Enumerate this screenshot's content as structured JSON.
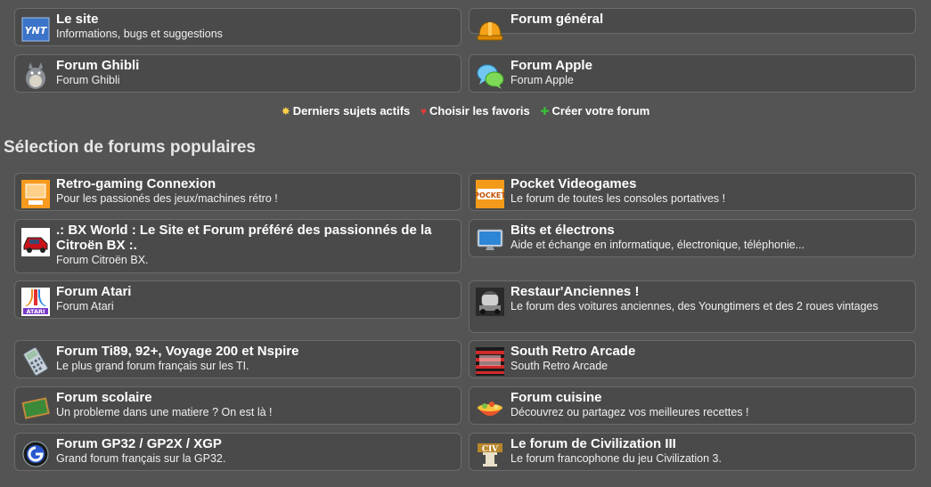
{
  "top_forums": [
    {
      "title": "Le site",
      "desc": "Informations, bugs et suggestions",
      "icon": "ynt-logo-icon"
    },
    {
      "title": "Forum général",
      "desc": "",
      "icon": "hardhat-icon"
    },
    {
      "title": "Forum Ghibli",
      "desc": "Forum Ghibli",
      "icon": "totoro-icon"
    },
    {
      "title": "Forum Apple",
      "desc": "Forum Apple",
      "icon": "chat-bubbles-icon"
    }
  ],
  "links": [
    {
      "label": "Derniers sujets actifs",
      "icon": "star-icon",
      "color": "#ffd24a"
    },
    {
      "label": "Choisir les favoris",
      "icon": "heart-icon",
      "color": "#e03a3a"
    },
    {
      "label": "Créer votre forum",
      "icon": "plus-icon",
      "color": "#38c038"
    }
  ],
  "section_title": "Sélection de forums populaires",
  "popular_forums": [
    {
      "title": "Retro-gaming Connexion",
      "desc": "Pour les passionés des jeux/machines rétro !",
      "icon": "retro-computer-icon"
    },
    {
      "title": "Pocket Videogames",
      "desc": "Le forum de toutes les consoles portatives !",
      "icon": "pocket-logo-icon"
    },
    {
      "title": ".: BX World : Le Site et Forum préféré des passionnés de la Citroën BX :.",
      "desc": "Forum Citroën BX.",
      "icon": "citroen-bx-icon"
    },
    {
      "title": "Bits et électrons",
      "desc": "Aide et échange en informatique, électronique, téléphonie...",
      "icon": "monitor-icon"
    },
    {
      "title": "Forum Atari",
      "desc": "Forum Atari",
      "icon": "atari-logo-icon"
    },
    {
      "title": "Restaur'Anciennes !",
      "desc": "Le forum des voitures anciennes, des Youngtimers et des 2 roues vintages",
      "icon": "vintage-car-icon"
    },
    {
      "title": "Forum Ti89, 92+, Voyage 200 et Nspire",
      "desc": "Le plus grand forum français sur les TI.",
      "icon": "calculator-icon"
    },
    {
      "title": "South Retro Arcade",
      "desc": "South Retro Arcade",
      "icon": "arcade-logo-icon"
    },
    {
      "title": "Forum scolaire",
      "desc": "Un probleme dans une matiere ? On est là !",
      "icon": "chalkboard-icon"
    },
    {
      "title": "Forum cuisine",
      "desc": "Découvrez ou partagez vos meilleures recettes !",
      "icon": "food-bowl-icon"
    },
    {
      "title": "Forum GP32 / GP2X / XGP",
      "desc": "Grand forum français sur la GP32.",
      "icon": "gp32-logo-icon"
    },
    {
      "title": "Le forum de Civilization III",
      "desc": "Le forum francophone du jeu Civilization 3.",
      "icon": "civ-logo-icon"
    }
  ]
}
